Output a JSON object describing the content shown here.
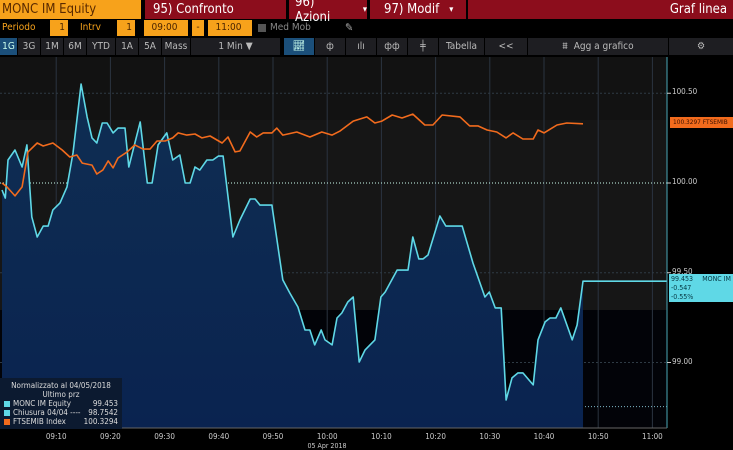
{
  "header": {
    "ticker": "MONC IM Equity",
    "compare": "95) Confronto",
    "actions": "96) Azioni",
    "modify": "97) Modif",
    "chart_type": "Graf linea"
  },
  "controls": {
    "period_label": "Periodo",
    "period_value": "1",
    "interval_label": "Intrv",
    "interval_value": "1",
    "start_time": "09:00",
    "dash": "-",
    "end_time": "11:00",
    "moving_avg": "Med Mob"
  },
  "toolbar": {
    "ranges": [
      "1G",
      "3G",
      "1M",
      "6M",
      "YTD",
      "1A",
      "5A",
      "Mass"
    ],
    "interval_select": "1 Min ▼",
    "table": "Tabella",
    "collapse": "<<",
    "add_to_chart": "Agg a grafico"
  },
  "legend": {
    "title": "Normalizzato al 04/05/2018",
    "subtitle": "Ultimo prz",
    "items": [
      {
        "name": "MONC IM Equity",
        "value": "99.453",
        "color": "#5fd8e6"
      },
      {
        "name": "Chiusura 04/04 ----",
        "value": "98.7542",
        "color": "#5fd8e6"
      },
      {
        "name": "FTSEMIB Index",
        "value": "100.3294",
        "color": "#f26b1d"
      }
    ]
  },
  "tags": {
    "ftsemib": "100.3297 FTSEMIB",
    "monc_value": "99.453",
    "monc_name": "MONC IM",
    "monc_change": "-0.547",
    "monc_pct": "-0.55%"
  },
  "chart_data": {
    "type": "line",
    "date_label": "05 Apr 2018",
    "x_unit": "minutes after 09:00",
    "xlim": [
      0,
      122
    ],
    "ylim": [
      98.68,
      100.7
    ],
    "x_ticks": [
      "09:10",
      "09:20",
      "09:30",
      "09:40",
      "09:50",
      "10:00",
      "10:10",
      "10:20",
      "10:30",
      "10:40",
      "10:50",
      "11:00"
    ],
    "y_ticks": [
      "100.50",
      "100.00",
      "99.50",
      "99.00"
    ],
    "y_tick_values": [
      100.5,
      100.0,
      99.5,
      99.0
    ],
    "reference_line": 100.0,
    "series": [
      {
        "name": "MONC IM Equity",
        "color": "#5fd8e6",
        "area": true,
        "points": [
          [
            0,
            99.961
          ],
          [
            0.6,
            99.916
          ],
          [
            1.1,
            100.128
          ],
          [
            2.4,
            100.184
          ],
          [
            3.7,
            100.089
          ],
          [
            4.6,
            100.212
          ],
          [
            5.5,
            99.811
          ],
          [
            6.5,
            99.699
          ],
          [
            7.6,
            99.76
          ],
          [
            8.5,
            99.76
          ],
          [
            9.4,
            99.85
          ],
          [
            10.7,
            99.889
          ],
          [
            12.0,
            99.978
          ],
          [
            13.1,
            100.167
          ],
          [
            14.6,
            100.551
          ],
          [
            15.7,
            100.368
          ],
          [
            16.6,
            100.251
          ],
          [
            17.5,
            100.223
          ],
          [
            18.5,
            100.334
          ],
          [
            19.4,
            100.334
          ],
          [
            20.5,
            100.279
          ],
          [
            21.4,
            100.306
          ],
          [
            22.7,
            100.306
          ],
          [
            23.4,
            100.089
          ],
          [
            25.5,
            100.34
          ],
          [
            26.8,
            100.0
          ],
          [
            27.7,
            100.0
          ],
          [
            28.8,
            100.212
          ],
          [
            30.4,
            100.279
          ],
          [
            31.5,
            100.128
          ],
          [
            32.8,
            100.156
          ],
          [
            33.8,
            100.0
          ],
          [
            34.7,
            100.0
          ],
          [
            35.6,
            100.089
          ],
          [
            36.5,
            100.072
          ],
          [
            37.8,
            100.128
          ],
          [
            38.9,
            100.128
          ],
          [
            39.9,
            100.15
          ],
          [
            40.8,
            100.15
          ],
          [
            42.6,
            99.699
          ],
          [
            43.9,
            99.794
          ],
          [
            45.8,
            99.911
          ],
          [
            46.7,
            99.911
          ],
          [
            47.6,
            99.877
          ],
          [
            49.8,
            99.877
          ],
          [
            51.8,
            99.46
          ],
          [
            53.1,
            99.387
          ],
          [
            54.6,
            99.309
          ],
          [
            55.9,
            99.181
          ],
          [
            56.8,
            99.181
          ],
          [
            57.7,
            99.098
          ],
          [
            58.9,
            99.181
          ],
          [
            59.6,
            99.126
          ],
          [
            60.9,
            99.098
          ],
          [
            61.8,
            99.248
          ],
          [
            62.7,
            99.276
          ],
          [
            63.8,
            99.337
          ],
          [
            64.8,
            99.365
          ],
          [
            65.9,
            99.003
          ],
          [
            67.0,
            99.07
          ],
          [
            68.8,
            99.126
          ],
          [
            69.9,
            99.365
          ],
          [
            70.7,
            99.393
          ],
          [
            72.9,
            99.515
          ],
          [
            74.9,
            99.515
          ],
          [
            75.8,
            99.699
          ],
          [
            76.9,
            99.577
          ],
          [
            77.7,
            99.577
          ],
          [
            78.6,
            99.599
          ],
          [
            80.8,
            99.816
          ],
          [
            81.9,
            99.76
          ],
          [
            84.9,
            99.76
          ],
          [
            86.9,
            99.554
          ],
          [
            89.1,
            99.365
          ],
          [
            89.9,
            99.393
          ],
          [
            91.0,
            99.304
          ],
          [
            92.1,
            99.304
          ],
          [
            93.0,
            98.791
          ],
          [
            94.1,
            98.914
          ],
          [
            95.2,
            98.942
          ],
          [
            96.1,
            98.942
          ],
          [
            98.0,
            98.875
          ],
          [
            98.9,
            99.126
          ],
          [
            100.2,
            99.226
          ],
          [
            101.1,
            99.248
          ],
          [
            102.2,
            99.248
          ],
          [
            103.1,
            99.304
          ],
          [
            105.2,
            99.126
          ],
          [
            106.1,
            99.209
          ],
          [
            107.2,
            99.453
          ]
        ]
      },
      {
        "name": "FTSEMIB Index",
        "color": "#f26b1d",
        "area": false,
        "points": [
          [
            0,
            100.0
          ],
          [
            0.9,
            99.978
          ],
          [
            2.4,
            99.928
          ],
          [
            3.7,
            99.978
          ],
          [
            4.8,
            100.173
          ],
          [
            6.5,
            100.223
          ],
          [
            7.6,
            100.206
          ],
          [
            9.4,
            100.223
          ],
          [
            11.1,
            100.184
          ],
          [
            12.5,
            100.145
          ],
          [
            13.8,
            100.156
          ],
          [
            14.8,
            100.111
          ],
          [
            16.6,
            100.1
          ],
          [
            17.5,
            100.05
          ],
          [
            18.6,
            100.072
          ],
          [
            19.6,
            100.123
          ],
          [
            20.5,
            100.084
          ],
          [
            21.4,
            100.139
          ],
          [
            23.1,
            100.173
          ],
          [
            24.5,
            100.212
          ],
          [
            26.0,
            100.189
          ],
          [
            27.3,
            100.189
          ],
          [
            28.6,
            100.234
          ],
          [
            30.1,
            100.234
          ],
          [
            31.5,
            100.251
          ],
          [
            32.5,
            100.279
          ],
          [
            34.1,
            100.267
          ],
          [
            35.6,
            100.273
          ],
          [
            36.9,
            100.251
          ],
          [
            38.4,
            100.262
          ],
          [
            40.6,
            100.223
          ],
          [
            41.7,
            100.256
          ],
          [
            43.0,
            100.173
          ],
          [
            43.9,
            100.178
          ],
          [
            45.8,
            100.284
          ],
          [
            47.0,
            100.256
          ],
          [
            48.2,
            100.279
          ],
          [
            49.8,
            100.279
          ],
          [
            50.7,
            100.306
          ],
          [
            51.8,
            100.267
          ],
          [
            54.4,
            100.284
          ],
          [
            56.8,
            100.256
          ],
          [
            59.0,
            100.284
          ],
          [
            60.9,
            100.267
          ],
          [
            62.4,
            100.29
          ],
          [
            64.8,
            100.345
          ],
          [
            67.3,
            100.368
          ],
          [
            68.8,
            100.334
          ],
          [
            70.1,
            100.345
          ],
          [
            72.0,
            100.379
          ],
          [
            73.8,
            100.362
          ],
          [
            75.8,
            100.384
          ],
          [
            78.0,
            100.323
          ],
          [
            79.5,
            100.323
          ],
          [
            81.2,
            100.379
          ],
          [
            84.5,
            100.368
          ],
          [
            86.3,
            100.318
          ],
          [
            87.8,
            100.318
          ],
          [
            89.5,
            100.295
          ],
          [
            91.3,
            100.284
          ],
          [
            93.0,
            100.251
          ],
          [
            94.3,
            100.279
          ],
          [
            96.1,
            100.245
          ],
          [
            98.0,
            100.245
          ],
          [
            98.9,
            100.295
          ],
          [
            100.0,
            100.279
          ],
          [
            102.4,
            100.323
          ],
          [
            104.2,
            100.334
          ],
          [
            107.2,
            100.33
          ]
        ]
      }
    ]
  }
}
